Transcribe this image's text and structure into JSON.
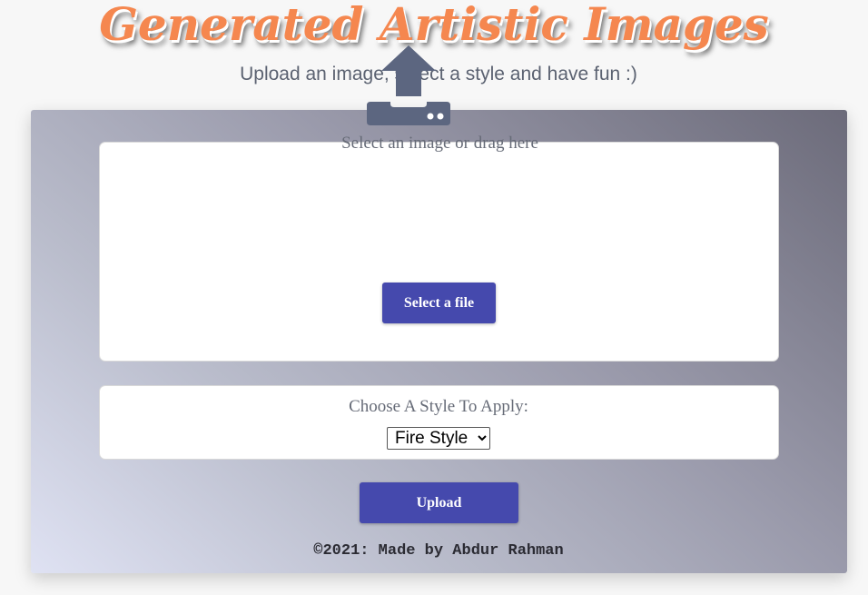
{
  "header": {
    "title": "Generated Artistic Images",
    "subtitle": "Upload an image, select a style and have fun :)"
  },
  "upload": {
    "icon": "upload-tray-icon",
    "hint": "Select an image or drag here",
    "select_button_label": "Select a file"
  },
  "style_picker": {
    "label": "Choose A Style To Apply:",
    "selected": "Fire Style"
  },
  "actions": {
    "upload_label": "Upload"
  },
  "footer": {
    "text": "©2021: Made by Abdur Rahman"
  },
  "colors": {
    "title": "#f5874f",
    "button": "#4549ad",
    "icon": "#5c6680"
  }
}
